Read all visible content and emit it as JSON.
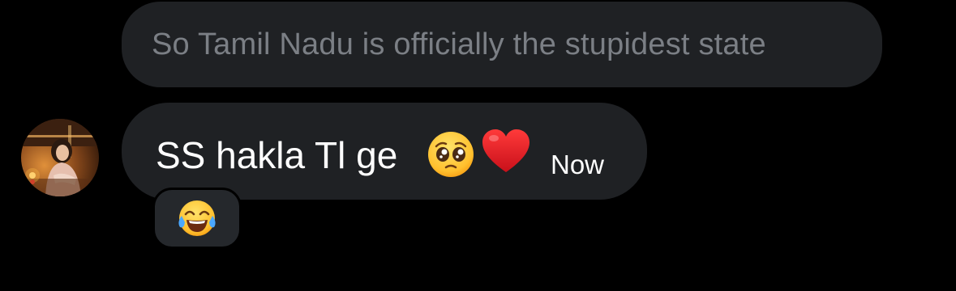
{
  "quoted_message": {
    "text": "So Tamil Nadu is officially the stupidest state"
  },
  "message": {
    "text": "SS hakla Tl ge",
    "emojis": [
      "pleading-face-emoji",
      "red-heart-emoji"
    ],
    "timestamp": "Now"
  },
  "reaction": {
    "emoji": "face-with-tears-of-joy-emoji"
  },
  "colors": {
    "background": "#000000",
    "bubble": "#1f2124",
    "quoted_text": "#7b7f85",
    "message_text": "#ffffff",
    "reaction_pill": "#25282c"
  }
}
